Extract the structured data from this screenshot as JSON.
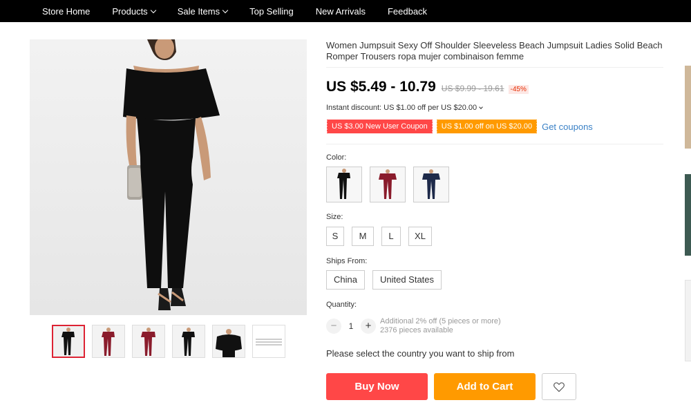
{
  "nav": {
    "items": [
      {
        "label": "Store Home",
        "dropdown": false
      },
      {
        "label": "Products",
        "dropdown": true
      },
      {
        "label": "Sale Items",
        "dropdown": true
      },
      {
        "label": "Top Selling",
        "dropdown": false
      },
      {
        "label": "New Arrivals",
        "dropdown": false
      },
      {
        "label": "Feedback",
        "dropdown": false
      }
    ]
  },
  "product": {
    "title": "Women Jumpsuit Sexy Off Shoulder Sleeveless Beach Jumpsuit Ladies Solid Beach Romper Trousers ropa mujer combinaison femme",
    "price": "US $5.49 - 10.79",
    "original_price": "US $9.99 - 19.61",
    "discount": "-45%",
    "instant_discount": "Instant discount: US $1.00 off per US $20.00",
    "coupons": [
      "US $3.00 New User Coupon",
      "US $1.00 off on US $20.00"
    ],
    "get_coupons_label": "Get coupons"
  },
  "color": {
    "label": "Color:",
    "swatches": [
      {
        "name": "black",
        "top": "#111111",
        "bottom": "#111111"
      },
      {
        "name": "wine-red",
        "top": "#8a1c2c",
        "bottom": "#7a1a2a"
      },
      {
        "name": "navy",
        "top": "#1e2a4a",
        "bottom": "#1e2a4a"
      }
    ]
  },
  "size": {
    "label": "Size:",
    "options": [
      "S",
      "M",
      "L",
      "XL"
    ]
  },
  "ships_from": {
    "label": "Ships From:",
    "options": [
      "China",
      "United States"
    ]
  },
  "quantity": {
    "label": "Quantity:",
    "minus": "−",
    "plus": "+",
    "value": "1",
    "note_line1": "Additional 2% off (5 pieces or more)",
    "note_line2": "2376 pieces available"
  },
  "ship_message": "Please select the country you want to ship from",
  "actions": {
    "buy_now": "Buy Now",
    "add_to_cart": "Add to Cart"
  },
  "colors": {
    "nav_bg": "#000000",
    "buy_now": "#ff4747",
    "add_to_cart": "#ff9a00",
    "coupon_red": "#ff4747",
    "coupon_orange": "#ff9a00",
    "link": "#3a81c6"
  }
}
